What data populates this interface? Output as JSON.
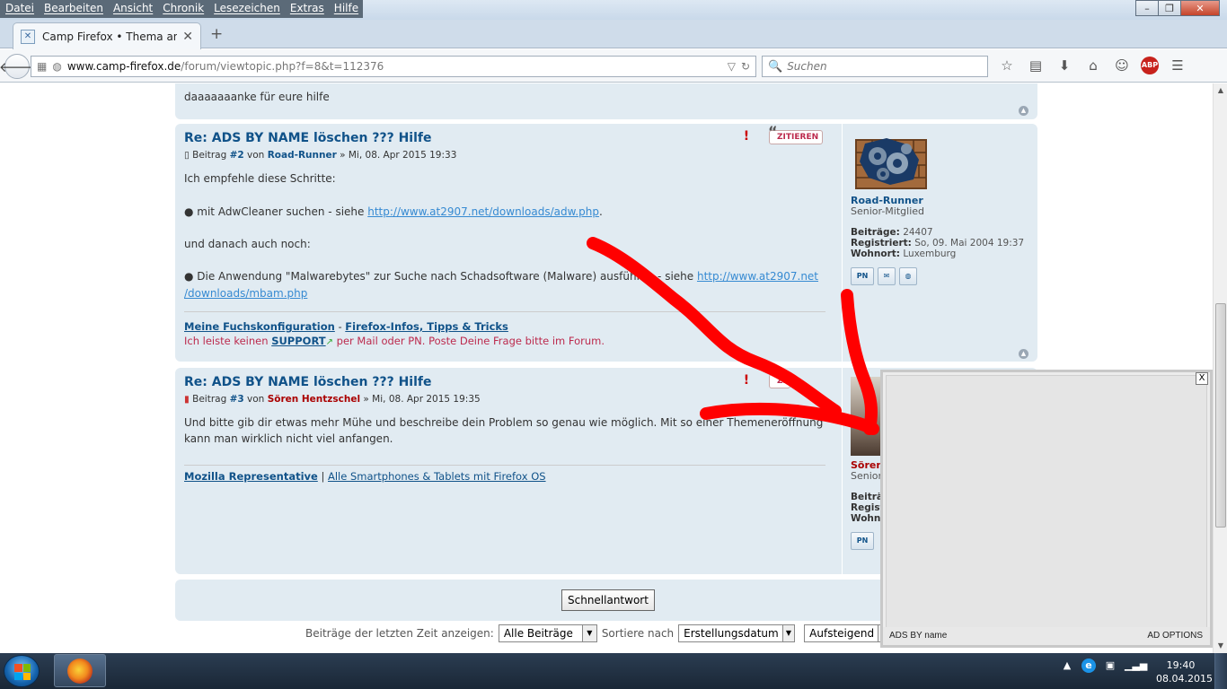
{
  "menu": [
    "Datei",
    "Bearbeiten",
    "Ansicht",
    "Chronik",
    "Lesezeichen",
    "Extras",
    "Hilfe"
  ],
  "window_controls": [
    "–",
    "❐",
    "✕"
  ],
  "tab": {
    "title": "Camp Firefox • Thema anz...",
    "close": "✕",
    "new_tab": "+"
  },
  "navbar": {
    "url_domain": "www.camp-firefox.de",
    "url_path": "/forum/viewtopic.php?f=8&t=112376",
    "search_placeholder": "Suchen",
    "abp": "ABP"
  },
  "post1": {
    "body": "daaaaaaanke für eure hilfe"
  },
  "post2": {
    "title": "Re: ADS BY NAME löschen ??? Hilfe",
    "meta_prefix": "Beitrag",
    "number": "#2",
    "von": "von",
    "author": "Road-Runner",
    "date": "» Mi, 08. Apr 2015 19:33",
    "quote": "ZITIEREN",
    "line1": "Ich empfehle diese Schritte:",
    "line2_text": "● mit AdwCleaner suchen - siehe ",
    "line2_link": "http://www.at2907.net/downloads/adw.php",
    "line3": "und danach auch noch:",
    "line4_text": "● Die Anwendung \"Malwarebytes\" zur Suche nach Schadsoftware (Malware) ausführen - siehe ",
    "line4_link_a": "http://www.at2907.net",
    "line4_link_b": "/downloads/mbam.php",
    "sig_link1": "Meine Fuchskonfiguration",
    "sig_sep": " - ",
    "sig_link2": "Firefox-Infos, Tipps & Tricks",
    "sig_red1": "Ich leiste keinen ",
    "sig_support": "SUPPORT",
    "sig_red2": " per Mail oder PN. Poste Deine Frage bitte im Forum.",
    "profile": {
      "name": "Road-Runner",
      "rank": "Senior-Mitglied",
      "posts_label": "Beiträge:",
      "posts": "24407",
      "reg_label": "Registriert:",
      "reg": "So, 09. Mai 2004 19:37",
      "loc_label": "Wohnort:",
      "loc": "Luxemburg",
      "pn": "PN"
    }
  },
  "post3": {
    "title": "Re: ADS BY NAME löschen ??? Hilfe",
    "meta_prefix": "Beitrag",
    "number": "#3",
    "von": "von",
    "author": "Sören Hentzschel",
    "date": "» Mi, 08. Apr 2015 19:35",
    "quote": "ZI",
    "line1": "Und bitte gib dir etwas mehr Mühe und beschreibe dein Problem so genau wie möglich. Mit so einer Themeneröffnung",
    "line2": "kann man wirklich nicht viel anfangen.",
    "sig_link1": "Mozilla Representative",
    "sig_sep": " | ",
    "sig_link2": "Alle Smartphones & Tablets mit Firefox OS",
    "profile": {
      "name": "Sören",
      "rank": "Senior",
      "posts_label": "Beiträ",
      "reg_label": "Regist",
      "loc_label": "Wohno",
      "pn": "PN"
    }
  },
  "quick_reply": "Schnellantwort",
  "sortbar": {
    "label1": "Beiträge der letzten Zeit anzeigen:",
    "select1": "Alle Beiträge",
    "label2": "Sortiere nach",
    "select2": "Erstellungsdatum",
    "select3": "Aufsteigend"
  },
  "ad": {
    "left": "ADS BY name",
    "right": "AD OPTIONS",
    "close": "X"
  },
  "clock": {
    "time": "19:40",
    "date": "08.04.2015"
  }
}
